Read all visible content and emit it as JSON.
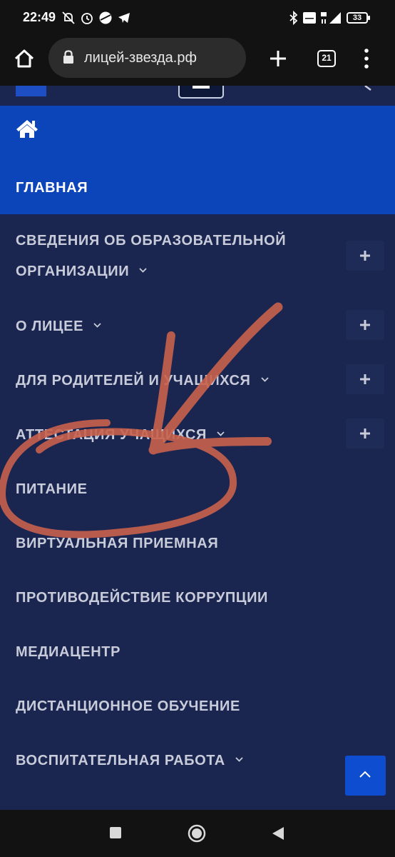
{
  "status_bar": {
    "time": "22:49",
    "icons": [
      "muted-alarm-icon",
      "alarm-clock-icon",
      "vpn-icon",
      "telegram-icon",
      "bluetooth-icon",
      "volte-icon",
      "network-4g-icon",
      "signal-icon"
    ],
    "battery_level": "33"
  },
  "browser": {
    "url": "лицей-звезда.рф",
    "tab_count": "21"
  },
  "menu": {
    "home_label": "ГЛАВНАЯ",
    "items": [
      {
        "label_line1": "СВЕДЕНИЯ ОБ ОБРАЗОВАТЕЛЬНОЙ",
        "label_line2": "ОРГАНИЗАЦИИ",
        "has_submenu": true
      },
      {
        "label": "О ЛИЦЕЕ",
        "has_submenu": true
      },
      {
        "label": "ДЛЯ РОДИТЕЛЕЙ И УЧАЩИХСЯ",
        "has_submenu": true
      },
      {
        "label": "АТТЕСТАЦИЯ УЧАЩИХСЯ",
        "has_submenu": true
      },
      {
        "label": "ПИТАНИЕ",
        "has_submenu": false
      },
      {
        "label": "ВИРТУАЛЬНАЯ ПРИЕМНАЯ",
        "has_submenu": false
      },
      {
        "label": "ПРОТИВОДЕЙСТВИЕ КОРРУПЦИИ",
        "has_submenu": false
      },
      {
        "label": "МЕДИАЦЕНТР",
        "has_submenu": false
      },
      {
        "label": "ДИСТАНЦИОННОЕ ОБУЧЕНИЕ",
        "has_submenu": false
      },
      {
        "label": "ВОСПИТАТЕЛЬНАЯ РАБОТА",
        "has_submenu": true
      }
    ]
  },
  "colors": {
    "menu_background": "#1b2650",
    "active_item": "#0c44b9",
    "menu_text": "#c8cbd9",
    "annotation": "#c8614c",
    "scroll_top_button": "#0e4dd0"
  }
}
